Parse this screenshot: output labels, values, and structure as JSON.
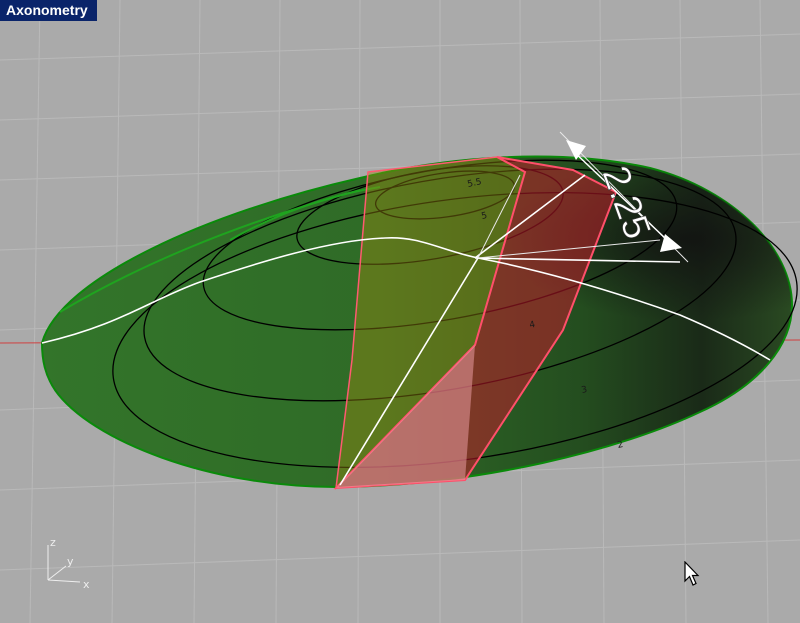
{
  "viewport": {
    "title": "Axonometry",
    "background_color": "#aaaaaa",
    "grid_color": "#b8b8b8",
    "axis_line_color": "#d04040"
  },
  "model": {
    "surface_color": "#2e6b26",
    "surface_edge_color": "#0a8a0a",
    "strip_color": "#c01a2a",
    "strip_edge_color": "#ff4f6a",
    "contour_color": "#000000",
    "curve_color": "#ffffff"
  },
  "dimension": {
    "value": "2.25",
    "color": "#ffffff"
  },
  "contour_labels": [
    "5.5",
    "5",
    "4",
    "3",
    "2"
  ],
  "axis_indicator": {
    "z_label": "z",
    "y_label": "y",
    "x_label": "x"
  },
  "cursor": {
    "icon": "arrow-cursor-icon"
  }
}
